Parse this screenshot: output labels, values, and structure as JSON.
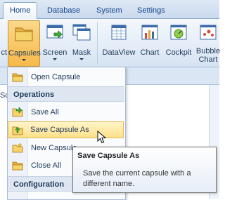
{
  "tabs": [
    "Home",
    "Database",
    "System",
    "Settings"
  ],
  "ribbon": {
    "buttons": [
      {
        "label": "ct",
        "icon": "partial-icon"
      },
      {
        "label": "Capsules",
        "icon": "folder-icon"
      },
      {
        "label": "Screen",
        "icon": "screen-icon"
      },
      {
        "label": "Mask",
        "icon": "mask-icon"
      },
      {
        "label": "DataView",
        "icon": "dataview-icon"
      },
      {
        "label": "Chart",
        "icon": "chart-icon"
      },
      {
        "label": "Cockpit",
        "icon": "cockpit-icon"
      },
      {
        "label": "Bubble",
        "label2": "Chart",
        "icon": "bubble-chart-icon"
      }
    ]
  },
  "side_text": "Sc",
  "menu": {
    "items": [
      {
        "type": "item",
        "label": "Open Capsule",
        "icon": "folder-open-icon"
      },
      {
        "type": "header",
        "label": "Operations"
      },
      {
        "type": "item",
        "label": "Save All",
        "icon": "save-all-icon"
      },
      {
        "type": "item",
        "label": "Save Capsule As",
        "icon": "save-as-icon",
        "highlighted": true
      },
      {
        "type": "item",
        "label": "New Capsule",
        "icon": "new-capsule-icon"
      },
      {
        "type": "item",
        "label": "Close All",
        "icon": "close-all-icon"
      },
      {
        "type": "header",
        "label": "Configuration"
      }
    ]
  },
  "tooltip": {
    "title": "Save Capsule As",
    "description": "Save the current capsule with a different name."
  }
}
